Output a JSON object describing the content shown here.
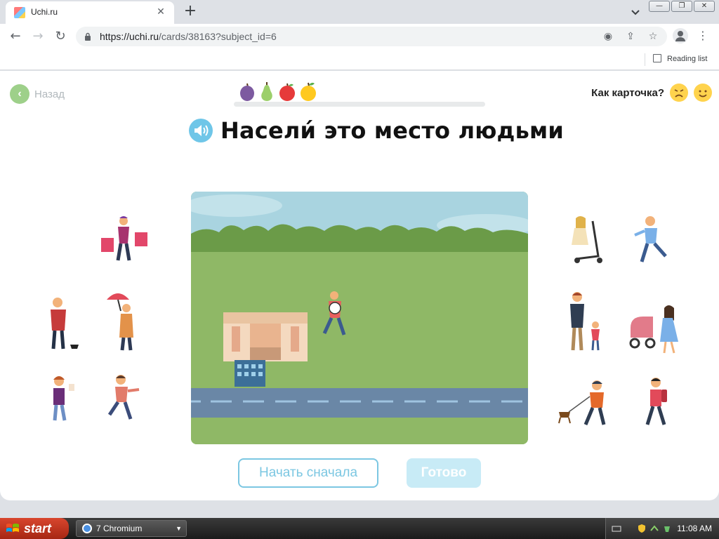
{
  "browser": {
    "tab_title": "Uchi.ru",
    "url_main": "https://uchi.ru",
    "url_rest": "/cards/38163?subject_id=6",
    "reading_list": "Reading list"
  },
  "page": {
    "back_label": "Назад",
    "rating_label": "Как карточка?",
    "title": "Насели́ это место людьми",
    "restart_button": "Начать сначала",
    "done_button": "Готово",
    "progress_fruits": [
      "plum",
      "pear",
      "apple",
      "lemon"
    ]
  },
  "colors": {
    "accent_blue": "#7cc7e2",
    "back_green": "#9ed08a",
    "grass": "#8fb866",
    "road": "#6a87a6",
    "sky": "#a9d4e0"
  },
  "taskbar": {
    "start_label": "start",
    "task_label": "7 Chromium",
    "clock": "11:08 AM"
  }
}
